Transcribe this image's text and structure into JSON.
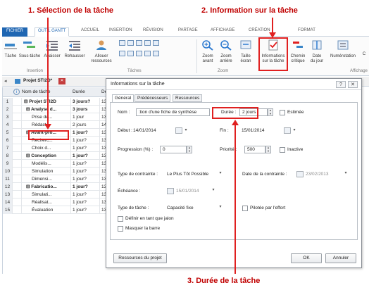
{
  "callouts": {
    "c1": "1. Sélection de la tâche",
    "c2": "2. Information sur la tâche",
    "c3": "3. Durée de la tâche"
  },
  "ribbon_tabs": [
    "FICHIER",
    "OUTIL GANTT",
    "ACCUEIL",
    "INSERTION",
    "RÉVISION",
    "PARTAGE",
    "AFFICHAGE",
    "CRÉATION",
    "FORMAT"
  ],
  "ribbon": {
    "tache": "Tâche",
    "sous_tache": "Sous-tâche",
    "abaisser": "Abaisser",
    "rehausser": "Rehausser",
    "allouer_1": "Allouer",
    "allouer_2": "ressources",
    "zoom_avant_1": "Zoom",
    "zoom_avant_2": "avant",
    "zoom_arriere_1": "Zoom",
    "zoom_arriere_2": "arrière",
    "taille_ecran_1": "Taille",
    "taille_ecran_2": "écran",
    "info_1": "Informations",
    "info_2": "sur la tâche",
    "chemin_1": "Chemin",
    "chemin_2": "critique",
    "date_1": "Date",
    "date_2": "du jour",
    "numerotation": "Numérotation",
    "c_partial": "C",
    "group_insertion": "Insertion",
    "group_taches": "Tâches",
    "group_zoom": "Zoom",
    "group_affichage": "Affichage"
  },
  "project_tab": "Projet STI2D*",
  "grid": {
    "headers": {
      "name": "Nom de tâche",
      "duration": "Durée",
      "start": "Déb"
    },
    "rows": [
      {
        "num": "1",
        "name": "⊟ Projet STI2D",
        "duration": "3 jours?",
        "start": "13",
        "bold": true
      },
      {
        "num": "2",
        "name": "⊟ Analyse d...",
        "duration": "3 jours",
        "start": "13",
        "bold": true
      },
      {
        "num": "3",
        "name": "Prise de...",
        "duration": "1 jour",
        "start": "13",
        "bold": false
      },
      {
        "num": "4",
        "name": "Rédact...",
        "duration": "2 jours",
        "start": "14",
        "bold": false
      },
      {
        "num": "5",
        "name": "⊟ Avant-pro...",
        "duration": "1 jour?",
        "start": "13",
        "bold": true
      },
      {
        "num": "6",
        "name": "Recherc...",
        "duration": "1 jour?",
        "start": "13",
        "bold": false
      },
      {
        "num": "7",
        "name": "Choix d...",
        "duration": "1 jour?",
        "start": "13",
        "bold": false
      },
      {
        "num": "8",
        "name": "⊟ Conception",
        "duration": "1 jour?",
        "start": "13",
        "bold": true
      },
      {
        "num": "9",
        "name": "Modélis...",
        "duration": "1 jour?",
        "start": "13",
        "bold": false
      },
      {
        "num": "10",
        "name": "Simulation",
        "duration": "1 jour?",
        "start": "13",
        "bold": false
      },
      {
        "num": "11",
        "name": "Dimensi...",
        "duration": "1 jour?",
        "start": "13",
        "bold": false
      },
      {
        "num": "12",
        "name": "⊟ Fabricatio...",
        "duration": "1 jour?",
        "start": "13",
        "bold": true
      },
      {
        "num": "13",
        "name": "Simulati...",
        "duration": "1 jour?",
        "start": "13",
        "bold": false
      },
      {
        "num": "14",
        "name": "Réalisat...",
        "duration": "1 jour?",
        "start": "13",
        "bold": false
      },
      {
        "num": "15",
        "name": "Évaluation",
        "duration": "1 jour?",
        "start": "13",
        "bold": false
      }
    ]
  },
  "dialog": {
    "title": "Informations sur la tâche",
    "help": "?",
    "close": "✕",
    "tabs": [
      "Général",
      "Prédécesseurs",
      "Ressources"
    ],
    "nom_label": "Nom :",
    "nom_value": ":tion d'une fiche de synthèse",
    "duree_label": "Durée :",
    "duree_value": "2 jours",
    "estimee_label": "Estimée",
    "debut_label": "Début :",
    "debut_value": "14/01/2014",
    "fin_label": "Fin :",
    "fin_value": "15/01/2014",
    "progression_label": "Progression (%) :",
    "progression_value": "0",
    "priorite_label": "Priorité :",
    "priorite_value": "500",
    "inactive_label": "Inactive",
    "contrainte_label": "Type de contrainte :",
    "contrainte_value": "Le Plus Tôt Possible",
    "date_contrainte_label": "Date de la contrainte :",
    "date_contrainte_value": "23/02/2013",
    "echeance_label": "Échéance :",
    "echeance_value": "15/01/2014",
    "type_tache_label": "Type de tâche :",
    "type_tache_value": "Capacité fixe",
    "pilotee_label": "Pilotée par l'effort",
    "jalon_label": "Définir en tant que jalon",
    "masquer_label": "Masquer la barre",
    "ressources_btn": "Ressources du projet",
    "ok_btn": "OK",
    "annuler_btn": "Annuler"
  },
  "colors": {
    "accent": "#1f66b2",
    "callout": "#c00000",
    "highlight": "#e02020"
  }
}
